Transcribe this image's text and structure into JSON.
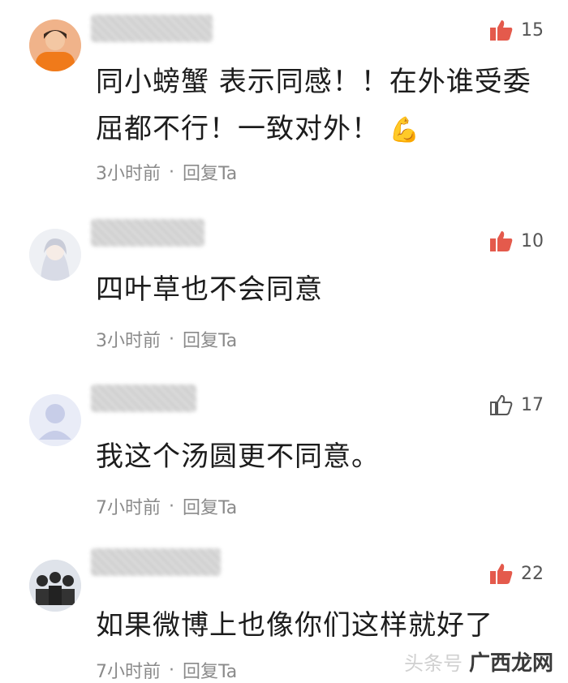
{
  "comments": [
    {
      "likes": "15",
      "liked": true,
      "text": "同小螃蟹 表示同感！！在外谁受委屈都不行！一致对外！",
      "emoji": "💪",
      "time": "3小时前",
      "dot": "·",
      "reply": "回复Ta"
    },
    {
      "likes": "10",
      "liked": true,
      "text": "四叶草也不会同意",
      "time": "3小时前",
      "dot": "·",
      "reply": "回复Ta"
    },
    {
      "likes": "17",
      "liked": false,
      "text": "我这个汤圆更不同意。",
      "time": "7小时前",
      "dot": "·",
      "reply": "回复Ta"
    },
    {
      "likes": "22",
      "liked": true,
      "text": "如果微博上也像你们这样就好了",
      "time": "7小时前",
      "dot": "·",
      "reply": "回复Ta"
    }
  ],
  "colors": {
    "like_active": "#e45a4c",
    "like_inactive": "#555555",
    "meta": "#8a8a8a"
  },
  "watermark": {
    "text": "头条号",
    "brand": "广西龙网"
  }
}
